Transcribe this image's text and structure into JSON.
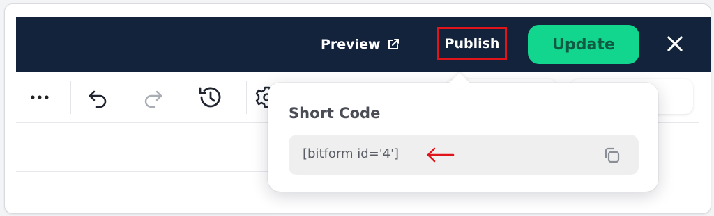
{
  "header": {
    "preview_label": "Preview",
    "publish_label": "Publish",
    "update_label": "Update",
    "icons": {
      "preview": "external-link-icon",
      "close": "close-icon"
    },
    "colors": {
      "bar": "#13233b",
      "update_bg": "#12d68d",
      "highlight": "#e0141b"
    }
  },
  "toolbar": {
    "icons": [
      "more-horizontal-icon",
      "undo-icon",
      "redo-icon",
      "history-icon",
      "settings-icon"
    ]
  },
  "popover": {
    "title": "Short Code",
    "code": "[bitform id='4']",
    "copy_icon": "copy-icon",
    "annotation_arrow": "left-arrow-icon"
  }
}
